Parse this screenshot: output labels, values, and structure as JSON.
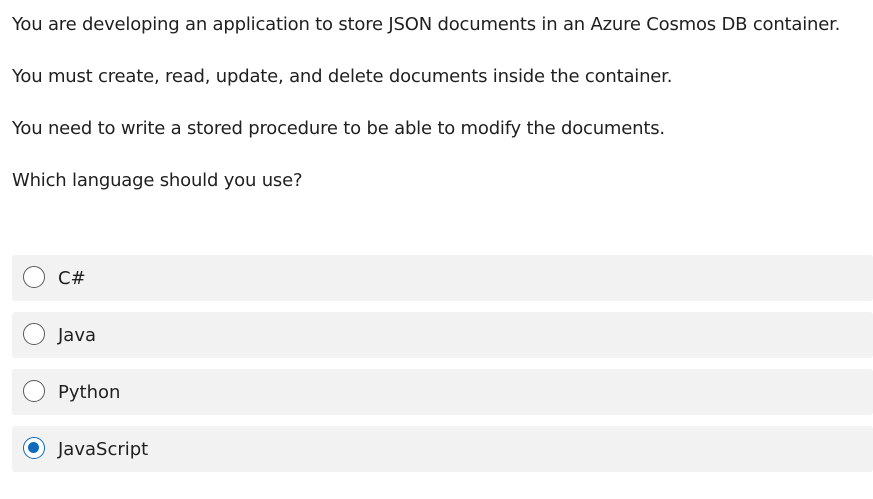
{
  "question": {
    "lines": [
      "You are developing an application to store JSON documents in an Azure Cosmos DB container.",
      "You must create, read, update, and delete documents inside the container.",
      "You need to write a stored procedure to be able to modify the documents.",
      "Which language should you use?"
    ]
  },
  "options": [
    {
      "label": "C#",
      "selected": false
    },
    {
      "label": "Java",
      "selected": false
    },
    {
      "label": "Python",
      "selected": false
    },
    {
      "label": "JavaScript",
      "selected": true
    }
  ],
  "colors": {
    "accent": "#0f6cbd",
    "option_background": "#f2f2f2",
    "text": "#1f1f1f"
  }
}
